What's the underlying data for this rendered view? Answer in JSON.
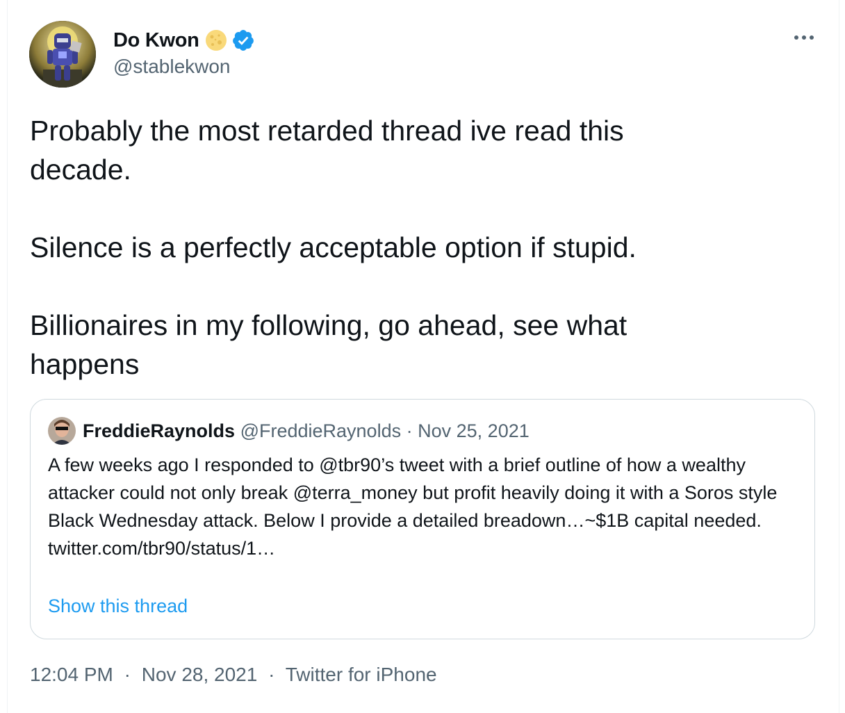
{
  "author": {
    "name": "Do Kwon",
    "handle": "@stablekwon",
    "badge_icons": [
      "moon-emoji-icon",
      "verified-badge-icon"
    ],
    "verified_color": "#1d9bf0"
  },
  "tweet": {
    "text": "Probably the most retarded thread ive read this\ndecade.\n\nSilence is a perfectly acceptable option if stupid.\n\nBillionaires in my following, go ahead, see what\nhappens"
  },
  "quoted_tweet": {
    "name": "FreddieRaynolds",
    "handle": "@FreddieRaynolds",
    "separator": "·",
    "date": "Nov 25, 2021",
    "text": "A few weeks ago I responded to @tbr90’s tweet with a brief outline of how a wealthy attacker could not only break @terra_money but profit heavily doing it with a Soros style Black Wednesday attack. Below I provide a detailed breadown…~$1B capital needed.",
    "link": "twitter.com/tbr90/status/1…",
    "show_thread_label": "Show this thread"
  },
  "footer": {
    "time": "12:04 PM",
    "date": "Nov 28, 2021",
    "source": "Twitter for iPhone",
    "separator": "·"
  },
  "colors": {
    "text_primary": "#0f1419",
    "text_secondary": "#536471",
    "accent": "#1d9bf0",
    "border": "#cfd9de"
  }
}
